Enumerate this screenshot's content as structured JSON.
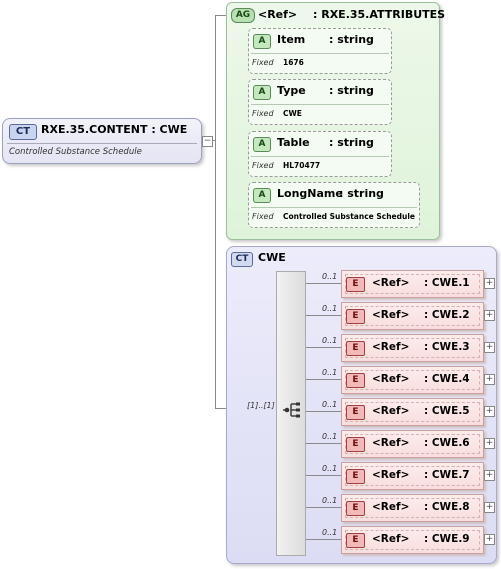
{
  "root": {
    "badge": "CT",
    "title": "RXE.35.CONTENT : CWE",
    "description": "Controlled Substance Schedule",
    "collapse_symbol": "−"
  },
  "attribute_group": {
    "badge": "AG",
    "ref": "<Ref>",
    "type": ": RXE.35.ATTRIBUTES",
    "attributes": [
      {
        "badge": "A",
        "name": "Item",
        "type": ": string",
        "fixed_label": "Fixed",
        "fixed_value": "1676"
      },
      {
        "badge": "A",
        "name": "Type",
        "type": ": string",
        "fixed_label": "Fixed",
        "fixed_value": "CWE"
      },
      {
        "badge": "A",
        "name": "Table",
        "type": ": string",
        "fixed_label": "Fixed",
        "fixed_value": "HL70477"
      },
      {
        "badge": "A",
        "name": "LongName",
        "type": ": string",
        "fixed_label": "Fixed",
        "fixed_value": "Controlled Substance Schedule"
      }
    ]
  },
  "complex_type": {
    "badge": "CT",
    "title": "CWE",
    "sequence_cardinality": "[1]..[1]",
    "elements": [
      {
        "badge": "E",
        "ref": "<Ref>",
        "type": ": CWE.1",
        "cardinality": "0..1",
        "expand_symbol": "+"
      },
      {
        "badge": "E",
        "ref": "<Ref>",
        "type": ": CWE.2",
        "cardinality": "0..1",
        "expand_symbol": "+"
      },
      {
        "badge": "E",
        "ref": "<Ref>",
        "type": ": CWE.3",
        "cardinality": "0..1",
        "expand_symbol": "+"
      },
      {
        "badge": "E",
        "ref": "<Ref>",
        "type": ": CWE.4",
        "cardinality": "0..1",
        "expand_symbol": "+"
      },
      {
        "badge": "E",
        "ref": "<Ref>",
        "type": ": CWE.5",
        "cardinality": "0..1",
        "expand_symbol": "+"
      },
      {
        "badge": "E",
        "ref": "<Ref>",
        "type": ": CWE.6",
        "cardinality": "0..1",
        "expand_symbol": "+"
      },
      {
        "badge": "E",
        "ref": "<Ref>",
        "type": ": CWE.7",
        "cardinality": "0..1",
        "expand_symbol": "+"
      },
      {
        "badge": "E",
        "ref": "<Ref>",
        "type": ": CWE.8",
        "cardinality": "0..1",
        "expand_symbol": "+"
      },
      {
        "badge": "E",
        "ref": "<Ref>",
        "type": ": CWE.9",
        "cardinality": "0..1",
        "expand_symbol": "+"
      }
    ]
  }
}
